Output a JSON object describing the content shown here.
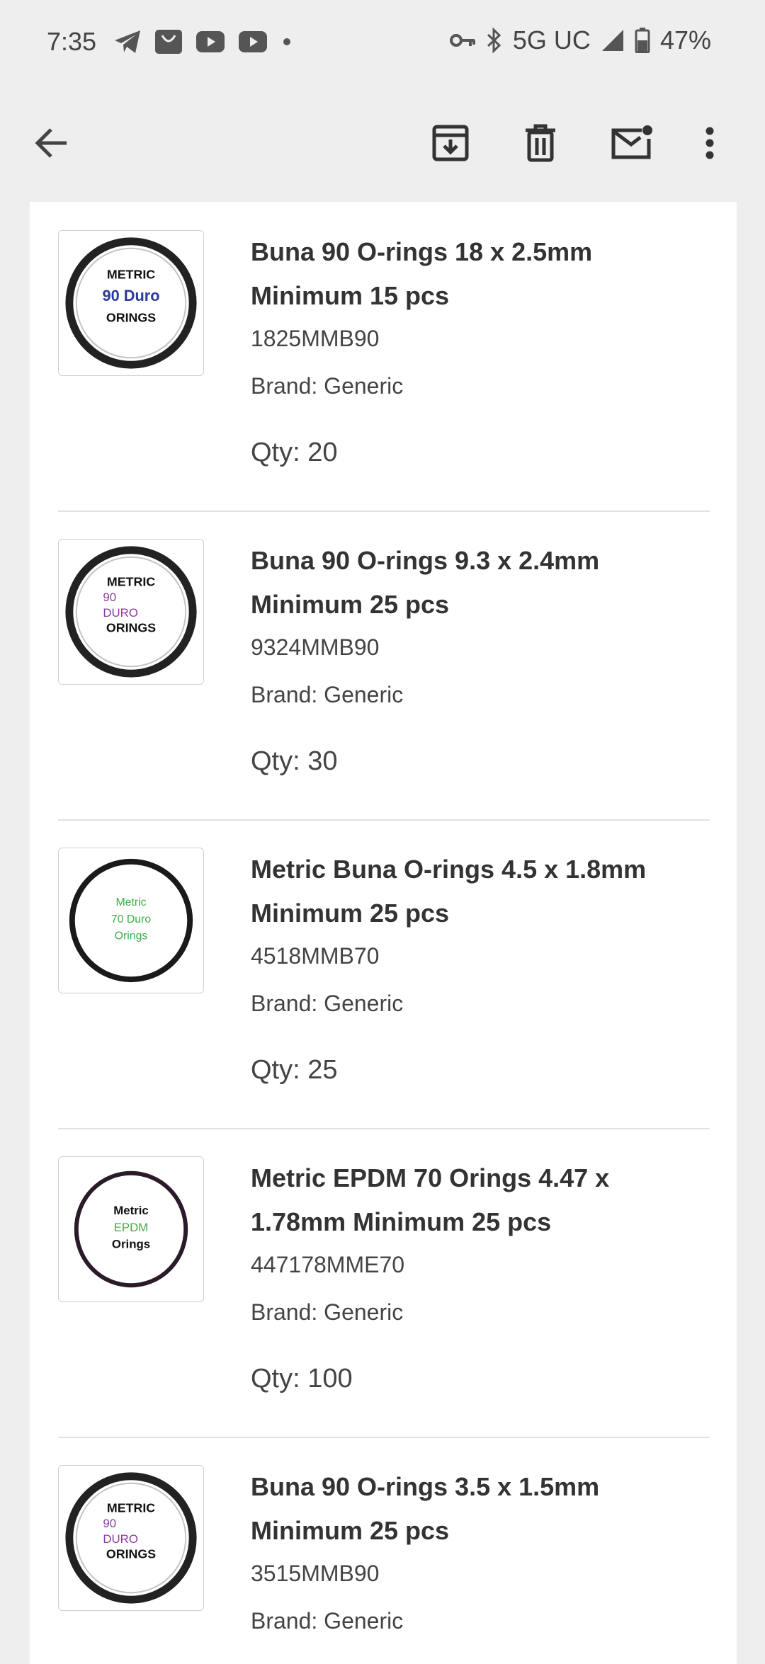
{
  "status_bar": {
    "time": "7:35",
    "network": "5G UC",
    "battery": "47%",
    "icons": [
      "telegram-icon",
      "shop-icon",
      "youtube-icon",
      "youtube-icon",
      "dot-icon",
      "vpn-key-icon",
      "bluetooth-icon",
      "signal-icon",
      "battery-icon"
    ]
  },
  "toolbar": {
    "icons": [
      "back-arrow-icon",
      "archive-icon",
      "delete-icon",
      "mark-unread-icon",
      "more-vert-icon"
    ]
  },
  "colors": {
    "background": "#eeeeee",
    "card": "#ffffff",
    "text": "#333333",
    "divider": "#e2e2e2"
  },
  "items": [
    {
      "title": "Buna 90 O-rings 18 x 2.5mm Minimum 15 pcs",
      "sku": "1825MMB90",
      "brand": "Brand: Generic",
      "qty": "Qty: 20",
      "image_lines": [
        "METRIC",
        "90 Duro",
        "ORINGS"
      ],
      "image_colors": [
        "#111111",
        "#2b3a9a",
        "#111111"
      ]
    },
    {
      "title": "Buna 90 O-rings 9.3 x 2.4mm Minimum 25 pcs",
      "sku": "9324MMB90",
      "brand": "Brand: Generic",
      "qty": "Qty: 30",
      "image_lines": [
        "METRIC",
        "90",
        "DURO",
        "ORINGS"
      ],
      "image_colors": [
        "#111111",
        "#8a3aa0",
        "#8a3aa0",
        "#111111"
      ]
    },
    {
      "title": "Metric Buna O-rings 4.5 x 1.8mm Minimum 25 pcs",
      "sku": "4518MMB70",
      "brand": "Brand: Generic",
      "qty": "Qty: 25",
      "image_lines": [
        "Metric",
        "70 Duro",
        "Orings"
      ],
      "image_colors": [
        "#3cb04a",
        "#3cb04a",
        "#3cb04a"
      ]
    },
    {
      "title": "Metric EPDM 70 Orings 4.47 x 1.78mm Minimum 25 pcs",
      "sku": "447178MME70",
      "brand": "Brand: Generic",
      "qty": "Qty: 100",
      "image_lines": [
        "Metric",
        "EPDM",
        "Orings"
      ],
      "image_colors": [
        "#111111",
        "#3cb04a",
        "#111111"
      ]
    },
    {
      "title": "Buna 90 O-rings 3.5 x 1.5mm Minimum 25 pcs",
      "sku": "3515MMB90",
      "brand": "Brand: Generic",
      "qty": "",
      "image_lines": [
        "METRIC",
        "90",
        "DURO",
        "ORINGS"
      ],
      "image_colors": [
        "#111111",
        "#8a3aa0",
        "#8a3aa0",
        "#111111"
      ]
    }
  ]
}
